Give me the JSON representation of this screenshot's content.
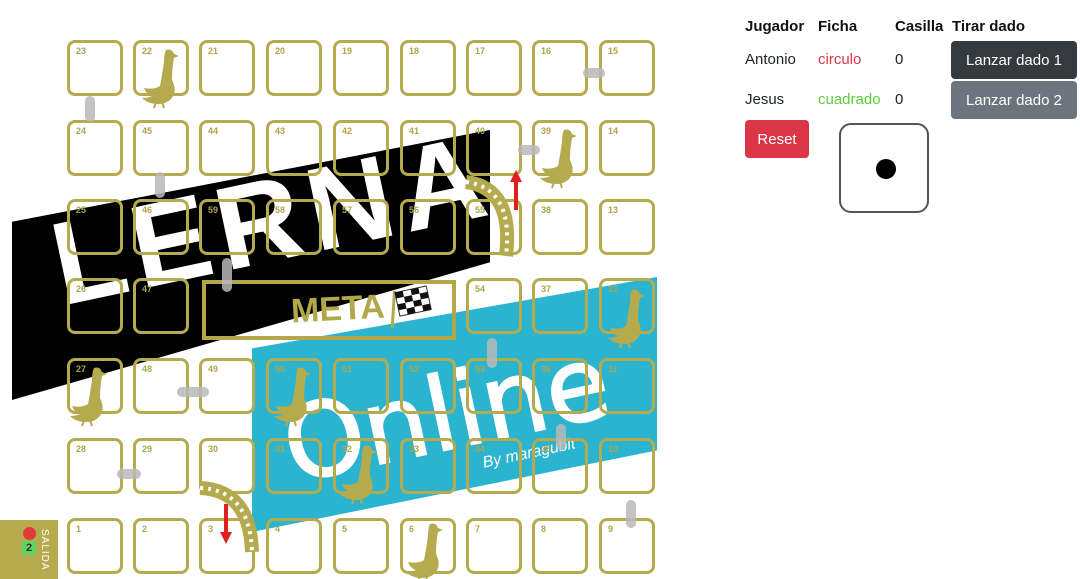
{
  "board": {
    "logo_text": "LERNA",
    "meta_text": "META",
    "online_text": "Online",
    "byline": "By maragubit",
    "start_label": "SALIDA",
    "start_token_number": "2",
    "cells": [
      {
        "n": "23"
      },
      {
        "n": "22"
      },
      {
        "n": "21"
      },
      {
        "n": "20"
      },
      {
        "n": "19"
      },
      {
        "n": "18"
      },
      {
        "n": "17"
      },
      {
        "n": "16"
      },
      {
        "n": "15"
      },
      {
        "n": "24"
      },
      {
        "n": "45"
      },
      {
        "n": "44"
      },
      {
        "n": "43"
      },
      {
        "n": "42"
      },
      {
        "n": "41"
      },
      {
        "n": "40"
      },
      {
        "n": "39"
      },
      {
        "n": "14"
      },
      {
        "n": "25"
      },
      {
        "n": "46"
      },
      {
        "n": "59"
      },
      {
        "n": "58"
      },
      {
        "n": "57"
      },
      {
        "n": "56"
      },
      {
        "n": "55"
      },
      {
        "n": "38"
      },
      {
        "n": "13"
      },
      {
        "n": "26"
      },
      {
        "n": "47"
      },
      {
        "n": ""
      },
      {
        "n": ""
      },
      {
        "n": ""
      },
      {
        "n": ""
      },
      {
        "n": "54"
      },
      {
        "n": "37"
      },
      {
        "n": "12"
      },
      {
        "n": "27"
      },
      {
        "n": "48"
      },
      {
        "n": "49"
      },
      {
        "n": "50"
      },
      {
        "n": "51"
      },
      {
        "n": "52"
      },
      {
        "n": "53"
      },
      {
        "n": "36"
      },
      {
        "n": "11"
      },
      {
        "n": "28"
      },
      {
        "n": "29"
      },
      {
        "n": "30"
      },
      {
        "n": "31"
      },
      {
        "n": "32"
      },
      {
        "n": "33"
      },
      {
        "n": "34"
      },
      {
        "n": "35"
      },
      {
        "n": "10"
      },
      {
        "n": "1"
      },
      {
        "n": "2"
      },
      {
        "n": "3"
      },
      {
        "n": "4"
      },
      {
        "n": "5"
      },
      {
        "n": "6"
      },
      {
        "n": "7"
      },
      {
        "n": "8"
      },
      {
        "n": "9"
      }
    ]
  },
  "table": {
    "headers": {
      "player": "Jugador",
      "token": "Ficha",
      "square": "Casilla",
      "roll": "Tirar dado"
    },
    "players": [
      {
        "name": "Antonio",
        "token": "circulo",
        "token_color": "#dc3545",
        "square": "0",
        "button": "Lanzar dado 1"
      },
      {
        "name": "Jesus",
        "token": "cuadrado",
        "token_color": "#5ccc3c",
        "square": "0",
        "button": "Lanzar dado 2"
      }
    ]
  },
  "reset_label": "Reset",
  "dice_value": 1,
  "colors": {
    "board_gold": "#b5ab4e",
    "blue_band": "#2bb4d0",
    "reset": "#dc3545",
    "dark_button": "#343a40",
    "gray_button": "#6c757d"
  }
}
